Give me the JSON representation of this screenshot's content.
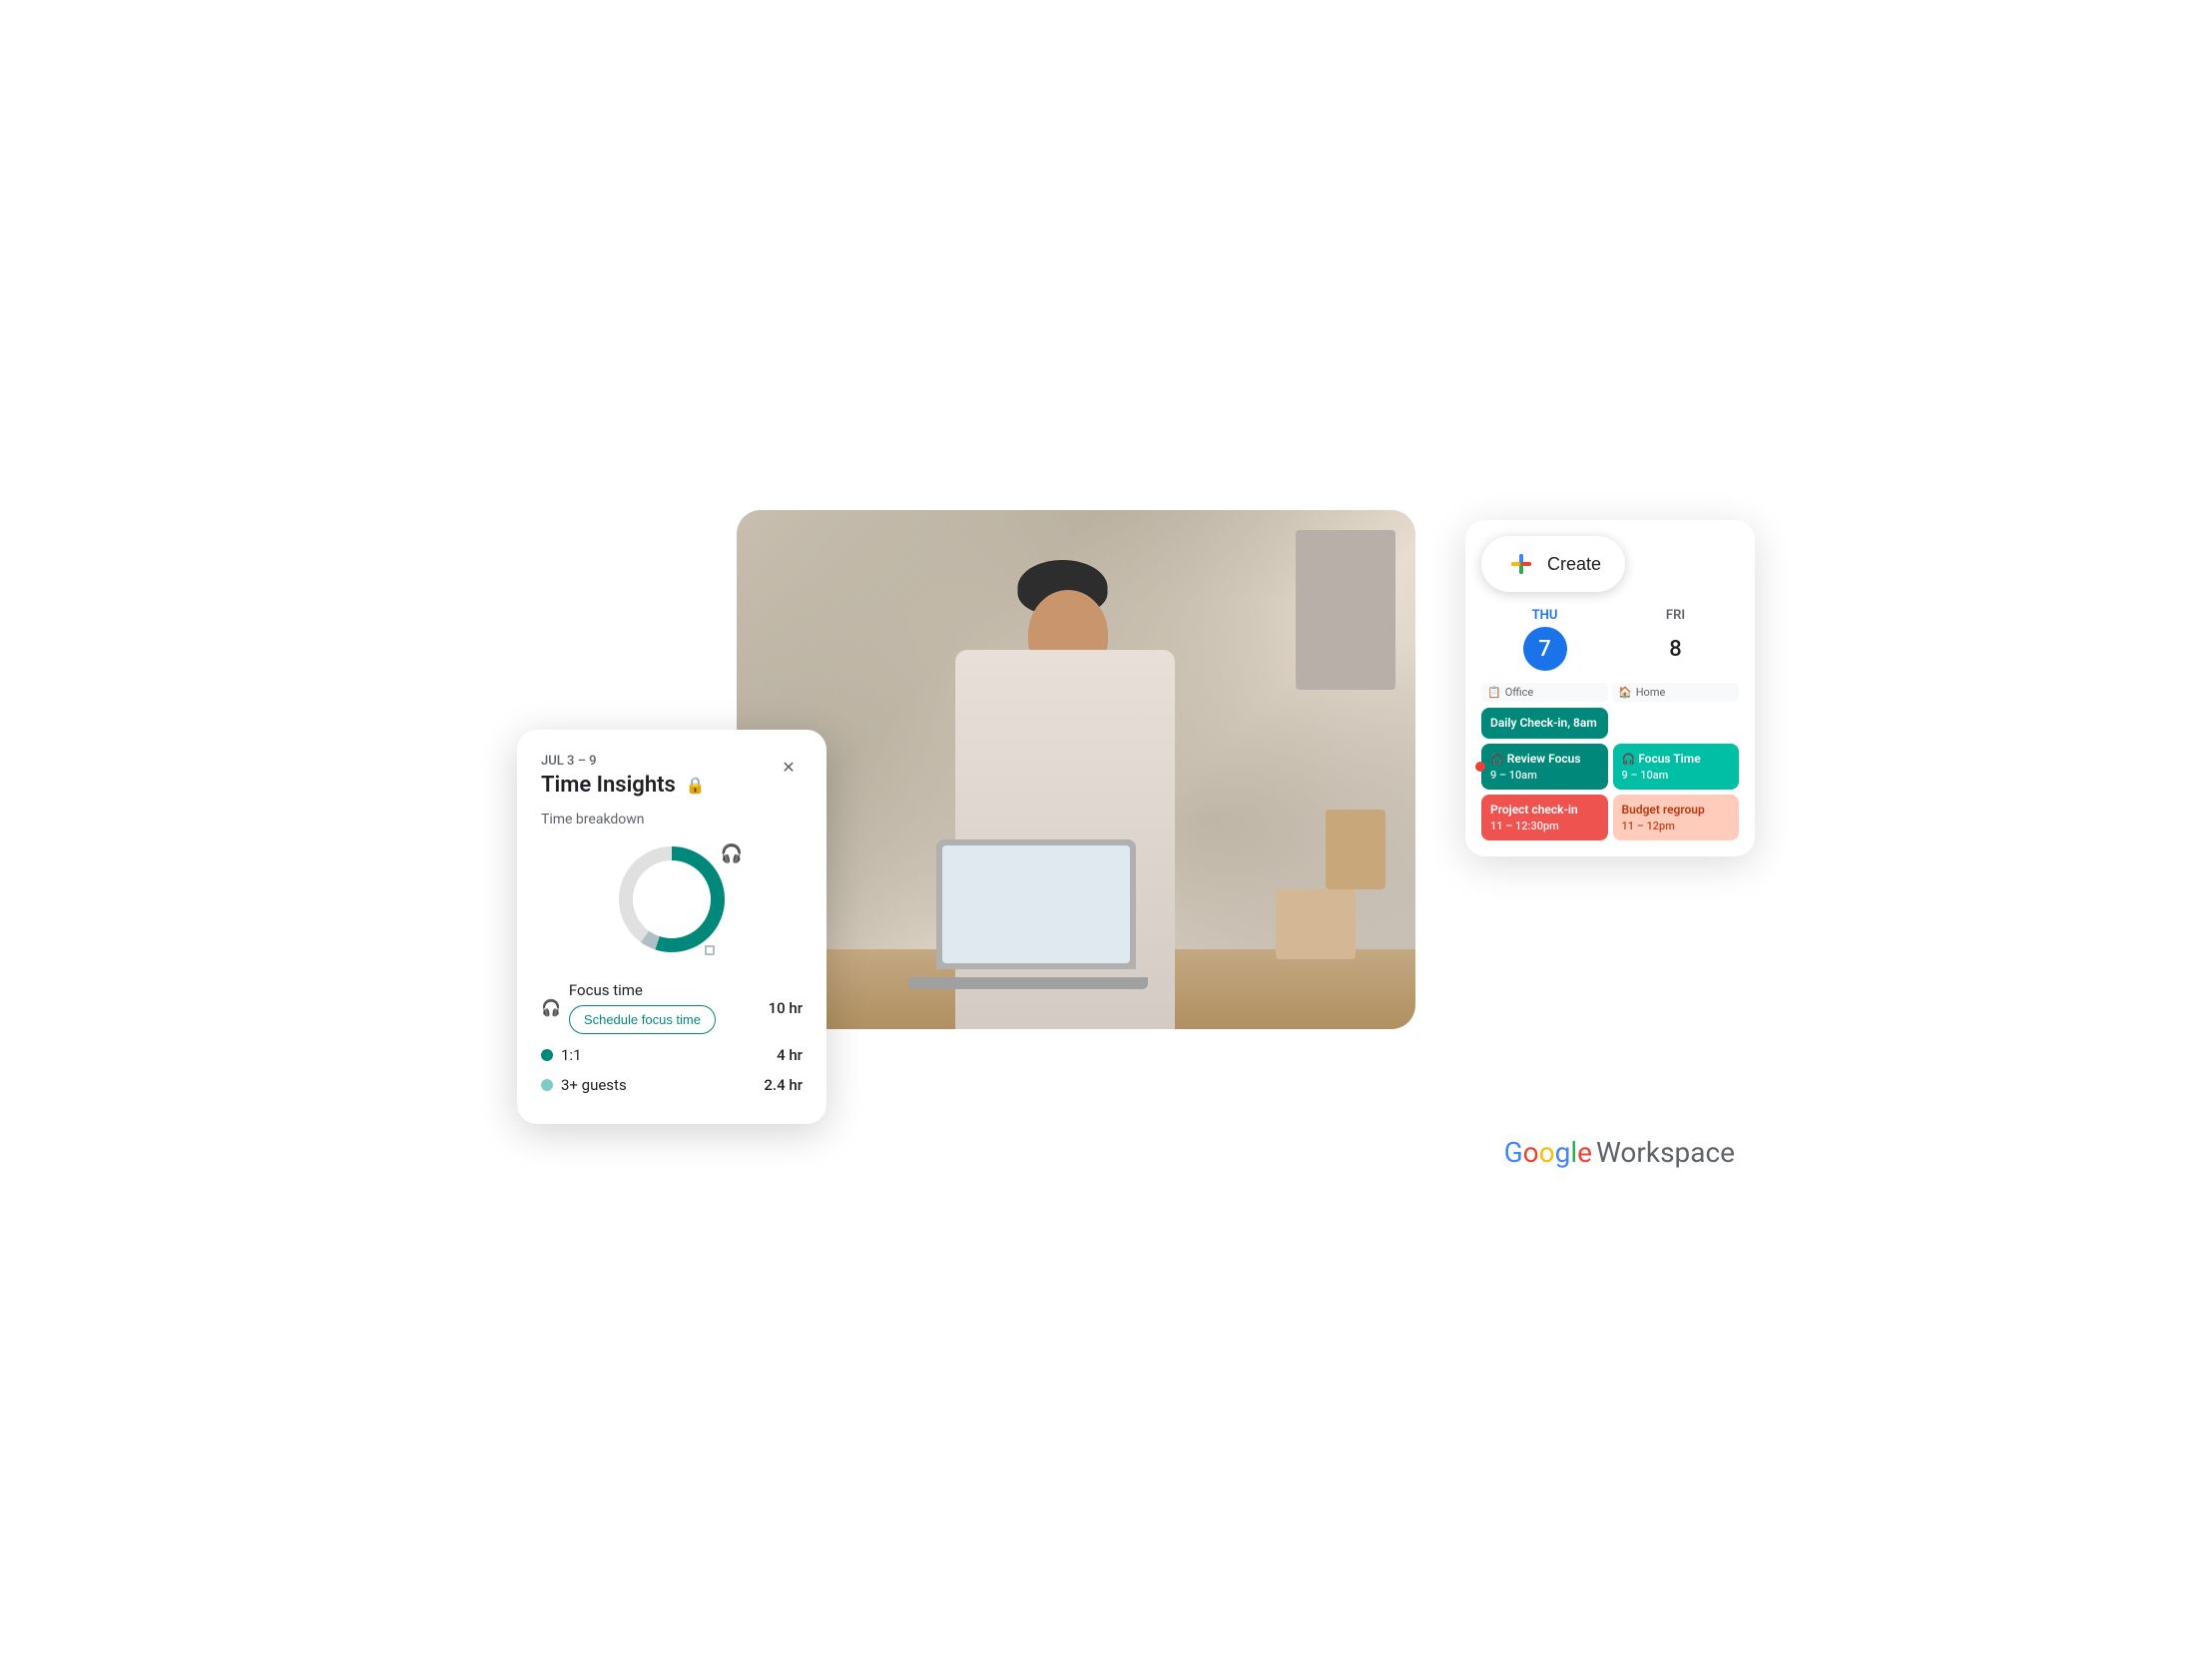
{
  "timeInsights": {
    "dateRange": "JUL 3 – 9",
    "title": "Time Insights",
    "lockIcon": "🔒",
    "closeIcon": "✕",
    "breakdown": {
      "label": "Time breakdown",
      "focusTime": {
        "label": "Focus time",
        "value": "10 hr",
        "scheduleBtn": "Schedule focus time"
      },
      "oneOnOne": {
        "label": "1:1",
        "value": "4 hr"
      },
      "threeGuests": {
        "label": "3+ guests",
        "value": "2.4 hr"
      }
    }
  },
  "calendar": {
    "createLabel": "Create",
    "days": [
      {
        "name": "THU",
        "number": "7",
        "active": true
      },
      {
        "name": "FRI",
        "number": "8",
        "active": false
      }
    ],
    "locations": [
      {
        "label": "Office",
        "icon": "📋"
      },
      {
        "label": "Home",
        "icon": "🏠"
      }
    ],
    "events": [
      {
        "title": "Daily Check-in, 8am",
        "time": "",
        "type": "teal",
        "col": "thu",
        "headphone": false
      },
      {
        "title": "Review Focus",
        "time": "9 – 10am",
        "type": "teal",
        "col": "thu",
        "headphone": true,
        "hasDot": true
      },
      {
        "title": "Focus Time",
        "time": "9 – 10am",
        "type": "teal-light",
        "col": "fri",
        "headphone": true
      },
      {
        "title": "Project check-in",
        "time": "11 – 12:30pm",
        "type": "red",
        "col": "thu",
        "headphone": false
      },
      {
        "title": "Budget regroup",
        "time": "11 – 12pm",
        "type": "red-light",
        "col": "fri",
        "headphone": false
      }
    ]
  },
  "branding": {
    "google": "Google",
    "workspace": "Workspace"
  },
  "donut": {
    "segments": [
      {
        "color": "#00897b",
        "pct": 55
      },
      {
        "color": "#e0e0e0",
        "pct": 40
      },
      {
        "color": "#b0bec5",
        "pct": 5
      }
    ]
  }
}
